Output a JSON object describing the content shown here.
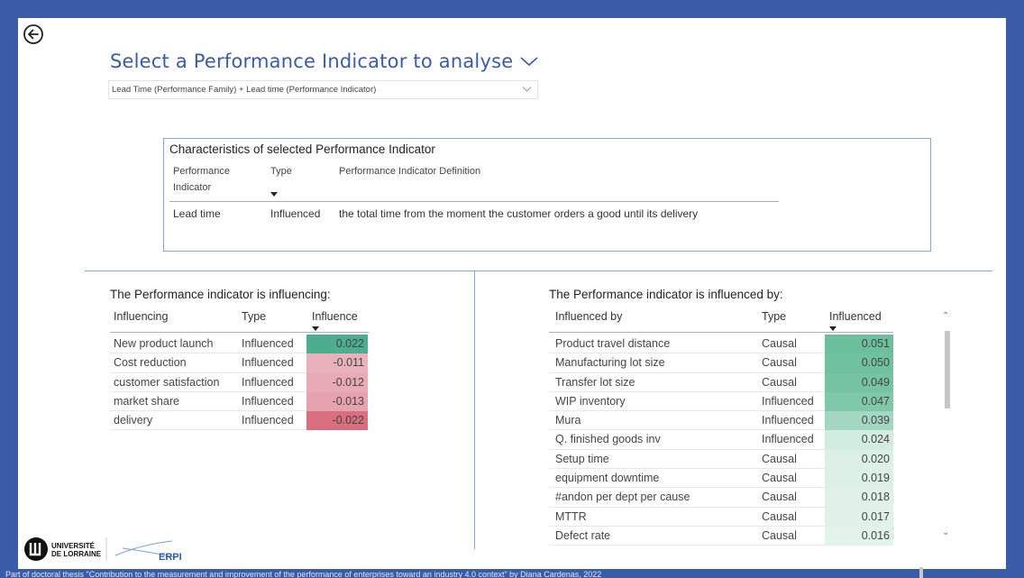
{
  "header": {
    "title": "Select a Performance Indicator to analyse",
    "selected_indicator": "Lead Time (Performance Family) + Lead time (Performance Indicator)"
  },
  "characteristics": {
    "title": "Characteristics of selected Performance Indicator",
    "columns": [
      "Performance Indicator",
      "Type",
      "Performance Indicator Definition"
    ],
    "row": {
      "indicator": "Lead time",
      "type": "Influenced",
      "definition": "the total time from the moment the customer orders a good until its delivery"
    }
  },
  "influencing": {
    "title": "The Performance indicator is influencing:",
    "columns": [
      "Influencing",
      "Type",
      "Influence"
    ],
    "rows": [
      {
        "name": "New product launch",
        "type": "Influenced",
        "value": "0.022",
        "color": "#4cae8e"
      },
      {
        "name": "Cost reduction",
        "type": "Influenced",
        "value": "-0.011",
        "color": "#e9b1bb"
      },
      {
        "name": "customer satisfaction",
        "type": "Influenced",
        "value": "-0.012",
        "color": "#e8aab5"
      },
      {
        "name": "market share",
        "type": "Influenced",
        "value": "-0.013",
        "color": "#e6a2af"
      },
      {
        "name": "delivery",
        "type": "Influenced",
        "value": "-0.022",
        "color": "#d96e7f"
      }
    ]
  },
  "influenced_by": {
    "title": "The Performance indicator is influenced by:",
    "columns": [
      "Influenced by",
      "Type",
      "Influenced"
    ],
    "rows": [
      {
        "name": "Product travel distance",
        "type": "Causal",
        "value": "0.051",
        "color": "#6cbf9c"
      },
      {
        "name": "Manufacturing lot size",
        "type": "Causal",
        "value": "0.050",
        "color": "#70c19f"
      },
      {
        "name": "Transfer lot size",
        "type": "Causal",
        "value": "0.049",
        "color": "#75c3a2"
      },
      {
        "name": "WIP inventory",
        "type": "Influenced",
        "value": "0.047",
        "color": "#80c8aa"
      },
      {
        "name": "Mura",
        "type": "Influenced",
        "value": "0.039",
        "color": "#a3d7c1"
      },
      {
        "name": "Q. finished goods inv",
        "type": "Influenced",
        "value": "0.024",
        "color": "#d3ece1"
      },
      {
        "name": "Setup time",
        "type": "Causal",
        "value": "0.020",
        "color": "#dcf0e7"
      },
      {
        "name": "equipment downtime",
        "type": "Causal",
        "value": "0.019",
        "color": "#ddf0e8"
      },
      {
        "name": "#andon per dept per cause",
        "type": "Causal",
        "value": "0.018",
        "color": "#dff1e9"
      },
      {
        "name": "MTTR",
        "type": "Causal",
        "value": "0.017",
        "color": "#e0f2ea"
      },
      {
        "name": "Defect rate",
        "type": "Causal",
        "value": "0.016",
        "color": "#e2f3eb"
      }
    ]
  },
  "logos": {
    "university_line1": "UNIVERSITÉ",
    "university_line2": "DE LORRAINE",
    "lab": "ERPI"
  },
  "footer": {
    "text": "Part of doctoral thesis \"Contribution to the measurement and improvement of the performance of enterprises toward an industry 4.0 context\" by Diana Cardenas, 2022"
  }
}
